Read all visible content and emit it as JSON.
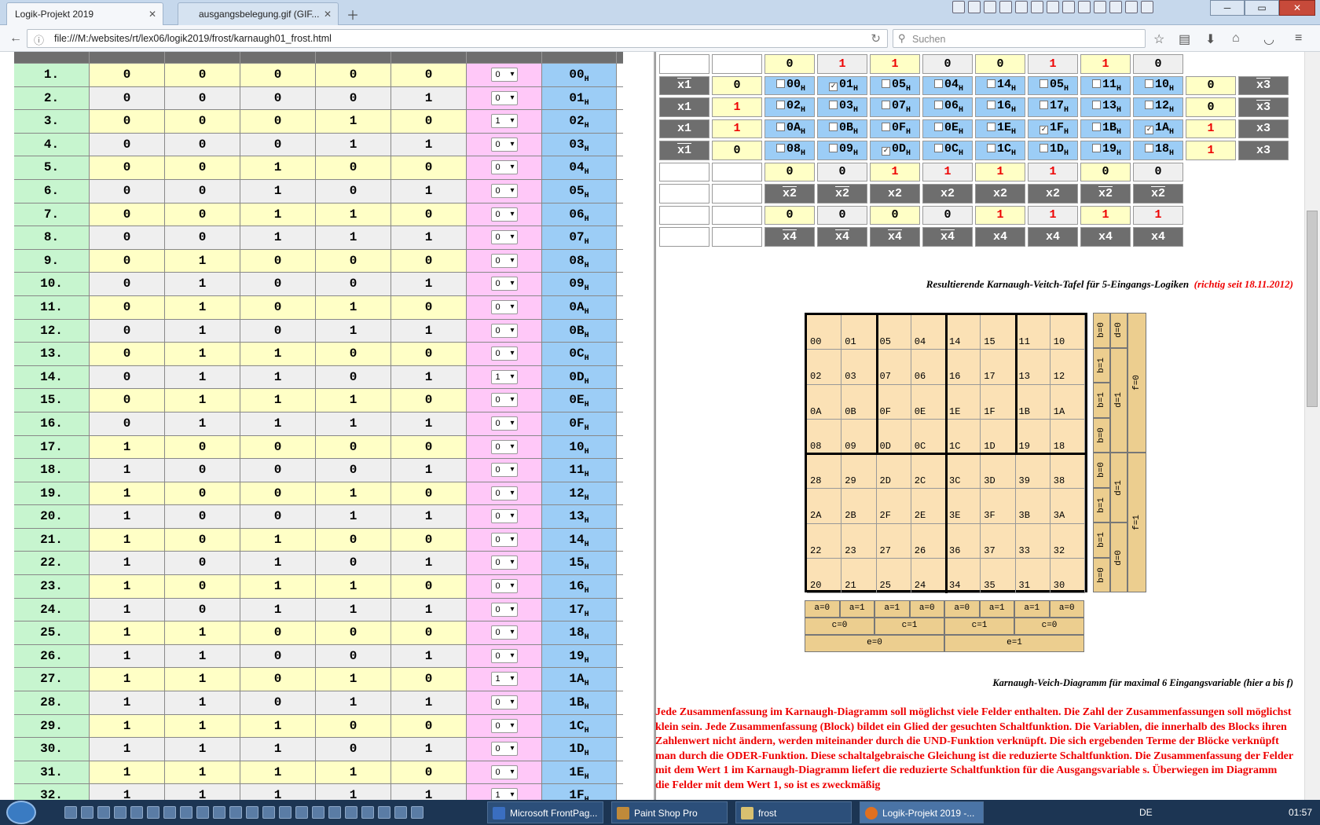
{
  "browser": {
    "tabs": [
      {
        "title": "Logik-Projekt 2019"
      },
      {
        "title": "ausgangsbelegung.gif (GIF..."
      }
    ],
    "url": "file:///M:/websites/rt/lex06/logik2019/frost/karnaugh01_frost.html",
    "search_placeholder": "Suchen",
    "window_buttons": [
      "─",
      "▭",
      "✕"
    ]
  },
  "truth_table": {
    "rows": [
      {
        "n": "1.",
        "b": [
          "0",
          "0",
          "0",
          "0",
          "0"
        ],
        "sel": "0",
        "hex": "00"
      },
      {
        "n": "2.",
        "b": [
          "0",
          "0",
          "0",
          "0",
          "1"
        ],
        "sel": "0",
        "hex": "01"
      },
      {
        "n": "3.",
        "b": [
          "0",
          "0",
          "0",
          "1",
          "0"
        ],
        "sel": "1",
        "hex": "02"
      },
      {
        "n": "4.",
        "b": [
          "0",
          "0",
          "0",
          "1",
          "1"
        ],
        "sel": "0",
        "hex": "03"
      },
      {
        "n": "5.",
        "b": [
          "0",
          "0",
          "1",
          "0",
          "0"
        ],
        "sel": "0",
        "hex": "04"
      },
      {
        "n": "6.",
        "b": [
          "0",
          "0",
          "1",
          "0",
          "1"
        ],
        "sel": "0",
        "hex": "05"
      },
      {
        "n": "7.",
        "b": [
          "0",
          "0",
          "1",
          "1",
          "0"
        ],
        "sel": "0",
        "hex": "06"
      },
      {
        "n": "8.",
        "b": [
          "0",
          "0",
          "1",
          "1",
          "1"
        ],
        "sel": "0",
        "hex": "07"
      },
      {
        "n": "9.",
        "b": [
          "0",
          "1",
          "0",
          "0",
          "0"
        ],
        "sel": "0",
        "hex": "08"
      },
      {
        "n": "10.",
        "b": [
          "0",
          "1",
          "0",
          "0",
          "1"
        ],
        "sel": "0",
        "hex": "09"
      },
      {
        "n": "11.",
        "b": [
          "0",
          "1",
          "0",
          "1",
          "0"
        ],
        "sel": "0",
        "hex": "0A"
      },
      {
        "n": "12.",
        "b": [
          "0",
          "1",
          "0",
          "1",
          "1"
        ],
        "sel": "0",
        "hex": "0B"
      },
      {
        "n": "13.",
        "b": [
          "0",
          "1",
          "1",
          "0",
          "0"
        ],
        "sel": "0",
        "hex": "0C"
      },
      {
        "n": "14.",
        "b": [
          "0",
          "1",
          "1",
          "0",
          "1"
        ],
        "sel": "1",
        "hex": "0D"
      },
      {
        "n": "15.",
        "b": [
          "0",
          "1",
          "1",
          "1",
          "0"
        ],
        "sel": "0",
        "hex": "0E"
      },
      {
        "n": "16.",
        "b": [
          "0",
          "1",
          "1",
          "1",
          "1"
        ],
        "sel": "0",
        "hex": "0F"
      },
      {
        "n": "17.",
        "b": [
          "1",
          "0",
          "0",
          "0",
          "0"
        ],
        "sel": "0",
        "hex": "10"
      },
      {
        "n": "18.",
        "b": [
          "1",
          "0",
          "0",
          "0",
          "1"
        ],
        "sel": "0",
        "hex": "11"
      },
      {
        "n": "19.",
        "b": [
          "1",
          "0",
          "0",
          "1",
          "0"
        ],
        "sel": "0",
        "hex": "12"
      },
      {
        "n": "20.",
        "b": [
          "1",
          "0",
          "0",
          "1",
          "1"
        ],
        "sel": "0",
        "hex": "13"
      },
      {
        "n": "21.",
        "b": [
          "1",
          "0",
          "1",
          "0",
          "0"
        ],
        "sel": "0",
        "hex": "14"
      },
      {
        "n": "22.",
        "b": [
          "1",
          "0",
          "1",
          "0",
          "1"
        ],
        "sel": "0",
        "hex": "15"
      },
      {
        "n": "23.",
        "b": [
          "1",
          "0",
          "1",
          "1",
          "0"
        ],
        "sel": "0",
        "hex": "16"
      },
      {
        "n": "24.",
        "b": [
          "1",
          "0",
          "1",
          "1",
          "1"
        ],
        "sel": "0",
        "hex": "17"
      },
      {
        "n": "25.",
        "b": [
          "1",
          "1",
          "0",
          "0",
          "0"
        ],
        "sel": "0",
        "hex": "18"
      },
      {
        "n": "26.",
        "b": [
          "1",
          "1",
          "0",
          "0",
          "1"
        ],
        "sel": "0",
        "hex": "19"
      },
      {
        "n": "27.",
        "b": [
          "1",
          "1",
          "0",
          "1",
          "0"
        ],
        "sel": "1",
        "hex": "1A"
      },
      {
        "n": "28.",
        "b": [
          "1",
          "1",
          "0",
          "1",
          "1"
        ],
        "sel": "0",
        "hex": "1B"
      },
      {
        "n": "29.",
        "b": [
          "1",
          "1",
          "1",
          "0",
          "0"
        ],
        "sel": "0",
        "hex": "1C"
      },
      {
        "n": "30.",
        "b": [
          "1",
          "1",
          "1",
          "0",
          "1"
        ],
        "sel": "0",
        "hex": "1D"
      },
      {
        "n": "31.",
        "b": [
          "1",
          "1",
          "1",
          "1",
          "0"
        ],
        "sel": "0",
        "hex": "1E"
      },
      {
        "n": "32.",
        "b": [
          "1",
          "1",
          "1",
          "1",
          "1"
        ],
        "sel": "1",
        "hex": "1F"
      }
    ],
    "hex_suffix": "H"
  },
  "kv_table": {
    "top_values": [
      "0",
      "1",
      "1",
      "0",
      "0",
      "1",
      "1",
      "0"
    ],
    "top_red": [
      false,
      true,
      true,
      false,
      false,
      true,
      true,
      false
    ],
    "rows": [
      {
        "left_label": "x1",
        "left_bar": true,
        "left_val": "0",
        "left_red": false,
        "cells": [
          {
            "hex": "00",
            "c": false
          },
          {
            "hex": "01",
            "c": true
          },
          {
            "hex": "05",
            "c": false
          },
          {
            "hex": "04",
            "c": false
          },
          {
            "hex": "14",
            "c": false
          },
          {
            "hex": "05",
            "c": false
          },
          {
            "hex": "11",
            "c": false
          },
          {
            "hex": "10",
            "c": false
          }
        ],
        "right_val": "0",
        "right_red": false,
        "right_label": "x3",
        "right_bar": true
      },
      {
        "left_label": "x1",
        "left_bar": false,
        "left_val": "1",
        "left_red": true,
        "cells": [
          {
            "hex": "02",
            "c": false
          },
          {
            "hex": "03",
            "c": false
          },
          {
            "hex": "07",
            "c": false
          },
          {
            "hex": "06",
            "c": false
          },
          {
            "hex": "16",
            "c": false
          },
          {
            "hex": "17",
            "c": false
          },
          {
            "hex": "13",
            "c": false
          },
          {
            "hex": "12",
            "c": false
          }
        ],
        "right_val": "0",
        "right_red": false,
        "right_label": "x3",
        "right_bar": true
      },
      {
        "left_label": "x1",
        "left_bar": false,
        "left_val": "1",
        "left_red": true,
        "cells": [
          {
            "hex": "0A",
            "c": false
          },
          {
            "hex": "0B",
            "c": false
          },
          {
            "hex": "0F",
            "c": false
          },
          {
            "hex": "0E",
            "c": false
          },
          {
            "hex": "1E",
            "c": false
          },
          {
            "hex": "1F",
            "c": true
          },
          {
            "hex": "1B",
            "c": false
          },
          {
            "hex": "1A",
            "c": true
          }
        ],
        "right_val": "1",
        "right_red": true,
        "right_label": "x3",
        "right_bar": false
      },
      {
        "left_label": "x1",
        "left_bar": true,
        "left_val": "0",
        "left_red": false,
        "cells": [
          {
            "hex": "08",
            "c": false
          },
          {
            "hex": "09",
            "c": false
          },
          {
            "hex": "0D",
            "c": true
          },
          {
            "hex": "0C",
            "c": false
          },
          {
            "hex": "1C",
            "c": false
          },
          {
            "hex": "1D",
            "c": false
          },
          {
            "hex": "19",
            "c": false
          },
          {
            "hex": "18",
            "c": false
          }
        ],
        "right_val": "1",
        "right_red": true,
        "right_label": "x3",
        "right_bar": false
      }
    ],
    "x2_values": [
      "0",
      "0",
      "1",
      "1",
      "1",
      "1",
      "0",
      "0"
    ],
    "x2_red": [
      false,
      false,
      true,
      true,
      true,
      true,
      false,
      false
    ],
    "x2_labels": [
      "x2",
      "x2",
      "x2",
      "x2",
      "x2",
      "x2",
      "x2",
      "x2"
    ],
    "x2_bar": [
      true,
      true,
      false,
      false,
      false,
      false,
      true,
      true
    ],
    "x4_values": [
      "0",
      "0",
      "0",
      "0",
      "1",
      "1",
      "1",
      "1"
    ],
    "x4_red": [
      false,
      false,
      false,
      false,
      true,
      true,
      true,
      true
    ],
    "x4_labels": [
      "x4",
      "x4",
      "x4",
      "x4",
      "x4",
      "x4",
      "x4",
      "x4"
    ],
    "x4_bar": [
      true,
      true,
      true,
      true,
      false,
      false,
      false,
      false
    ]
  },
  "caption1": {
    "text": "Resultierende Karnaugh-Veitch-Tafel für 5-Eingangs-Logiken",
    "note": "(richtig seit 18.11.2012)"
  },
  "kv6": {
    "cells": [
      [
        "00",
        "01",
        "05",
        "04",
        "14",
        "15",
        "11",
        "10"
      ],
      [
        "02",
        "03",
        "07",
        "06",
        "16",
        "17",
        "13",
        "12"
      ],
      [
        "0A",
        "0B",
        "0F",
        "0E",
        "1E",
        "1F",
        "1B",
        "1A"
      ],
      [
        "08",
        "09",
        "0D",
        "0C",
        "1C",
        "1D",
        "19",
        "18"
      ],
      [
        "28",
        "29",
        "2D",
        "2C",
        "3C",
        "3D",
        "39",
        "38"
      ],
      [
        "2A",
        "2B",
        "2F",
        "2E",
        "3E",
        "3F",
        "3B",
        "3A"
      ],
      [
        "22",
        "23",
        "27",
        "26",
        "36",
        "37",
        "33",
        "32"
      ],
      [
        "20",
        "21",
        "25",
        "24",
        "34",
        "35",
        "31",
        "30"
      ]
    ],
    "b_labels": [
      "b=0",
      "b=1",
      "b=1",
      "b=0",
      "b=0",
      "b=1",
      "b=1",
      "b=0"
    ],
    "d_labels": [
      "d=0",
      "d=1",
      "d=1",
      "d=0"
    ],
    "f_labels": [
      "f=0",
      "f=1"
    ],
    "a_labels": [
      "a=0",
      "a=1",
      "a=1",
      "a=0",
      "a=0",
      "a=1",
      "a=1",
      "a=0"
    ],
    "c_labels": [
      "c=0",
      "c=1",
      "c=1",
      "c=0"
    ],
    "e_labels": [
      "e=0",
      "e=1"
    ]
  },
  "caption2": "Karnaugh-Veich-Diagramm für maximal 6 Eingangsvariable (hier a bis f)",
  "paragraph": "Jede Zusammenfassung im Karnaugh-Diagramm soll möglichst viele Felder enthalten. Die Zahl der Zusammenfassungen soll möglichst klein sein. Jede Zusammenfassung (Block) bildet ein Glied der gesuchten Schaltfunktion. Die Variablen, die innerhalb des Blocks ihren Zahlenwert nicht ändern, werden miteinander durch die UND-Funktion verknüpft. Die sich ergebenden Terme der Blöcke verknüpft man durch die ODER-Funktion. Diese schaltalgebraische Gleichung ist die reduzierte Schaltfunktion. Die Zusammenfassung der Felder mit dem Wert 1 im Karnaugh-Diagramm liefert die reduzierte Schaltfunktion für die Ausgangsvariable s. Überwiegen im Diagramm die Felder mit dem Wert 1, so ist es zweckmäßig",
  "taskbar": {
    "items": [
      {
        "label": "Microsoft FrontPag...",
        "color": "#3a6ec0"
      },
      {
        "label": "Paint Shop Pro",
        "color": "#c08a3a"
      },
      {
        "label": "frost",
        "color": "#d8c070"
      },
      {
        "label": "Logik-Projekt 2019 -...",
        "color": "#e07020"
      }
    ],
    "lang": "DE",
    "time": "01:57"
  }
}
